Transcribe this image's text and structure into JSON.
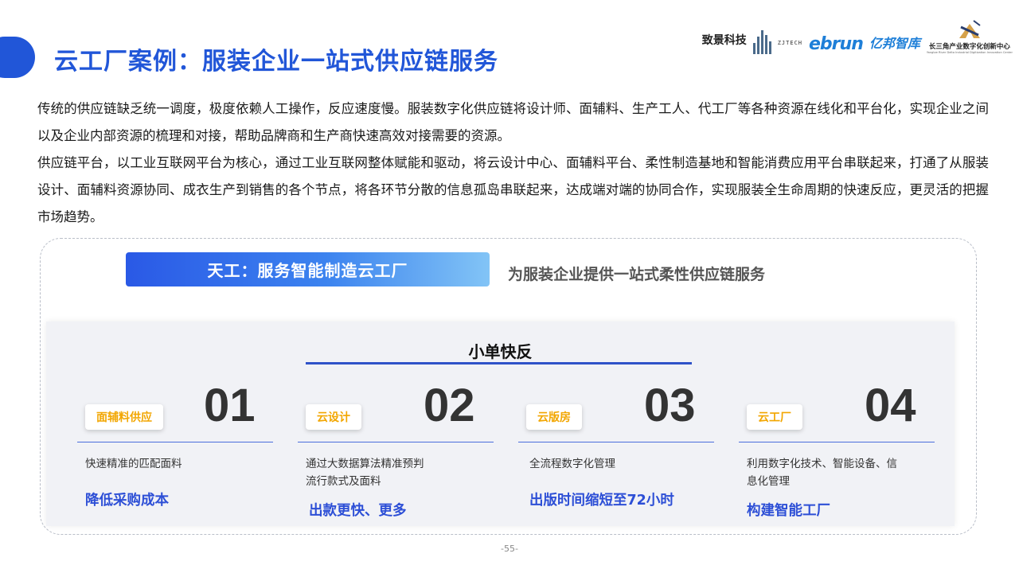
{
  "title": "云工厂案例：服装企业一站式供应链服务",
  "logos": {
    "zjtech_cn": "致景科技",
    "zjtech_en": "ZJTECH",
    "ebrun": "ebrun",
    "ebrun_cn": "亿邦智库",
    "yrd_cn": "长三角产业数字化创新中心",
    "yrd_en": "Yangtze River Delta Industrial Digitization Innovation Center"
  },
  "intro": {
    "p1": "传统的供应链缺乏统一调度，极度依赖人工操作，反应速度慢。服装数字化供应链将设计师、面辅料、生产工人、代工厂等各种资源在线化和平台化，实现企业之间以及企业内部资源的梳理和对接，帮助品牌商和生产商快速高效对接需要的资源。",
    "p2": "供应链平台，以工业互联网平台为核心，通过工业互联网整体赋能和驱动，将云设计中心、面辅料平台、柔性制造基地和智能消费应用平台串联起来，打通了从服装设计、面辅料资源协同、成衣生产到销售的各个节点，将各环节分散的信息孤岛串联起来，达成端对端的协同合作，实现服装全生命周期的快速反应，更灵活的把握市场趋势。"
  },
  "banner": {
    "label": "天工：服务智能制造云工厂",
    "subtitle": "为服装企业提供一站式柔性供应链服务"
  },
  "panel": {
    "title": "小单快反",
    "items": [
      {
        "tag": "面辅料供应",
        "number": "01",
        "desc": "快速精准的匹配面料",
        "result": "降低采购成本"
      },
      {
        "tag": "云设计",
        "number": "02",
        "desc": "通过大数据算法精准预判流行款式及面料",
        "result": "出款更快、更多"
      },
      {
        "tag": "云版房",
        "number": "03",
        "desc": "全流程数字化管理",
        "result": "出版时间缩短至72小时"
      },
      {
        "tag": "云工厂",
        "number": "04",
        "desc": "利用数字化技术、智能设备、信息化管理",
        "result": "构建智能工厂"
      }
    ]
  },
  "page_number": "-55-",
  "colors": {
    "accent": "#2156d8",
    "tag_text": "#f2a600",
    "result_text": "#2d4fd6"
  }
}
